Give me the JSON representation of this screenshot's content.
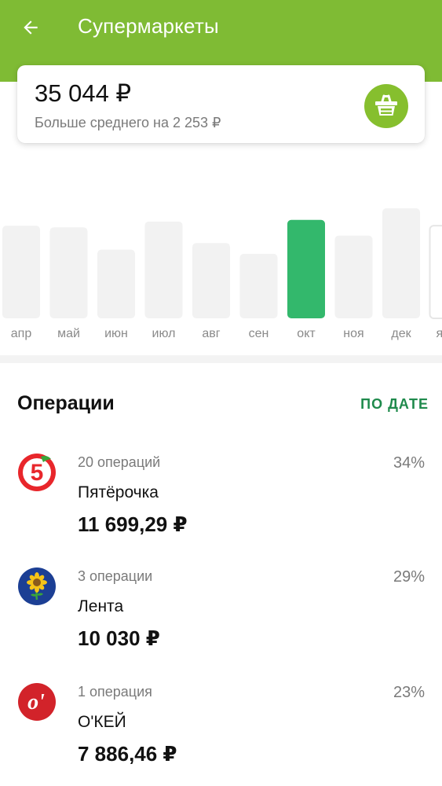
{
  "header": {
    "title": "Супермаркеты",
    "back_icon": "arrow-left-icon",
    "background_color": "#7fbb34"
  },
  "summary": {
    "amount": "35 044 ₽",
    "comparison": "Больше среднего на 2 253 ₽",
    "icon": "basket-icon",
    "icon_color": "#86bf2e"
  },
  "chart_data": {
    "type": "bar",
    "categories": [
      "апр",
      "май",
      "июн",
      "июл",
      "авг",
      "сен",
      "окт",
      "ноя",
      "дек",
      "я"
    ],
    "values": [
      112,
      110,
      83,
      117,
      91,
      78,
      119,
      100,
      133,
      112
    ],
    "selected": "окт",
    "colors": {
      "bar": "#f2f2f2",
      "selected_bar": "#33b86c"
    }
  },
  "operations": {
    "title": "Операции",
    "sort_label": "ПО ДАТЕ",
    "items": [
      {
        "count": "20 операций",
        "name": "Пятёрочка",
        "amount": "11 699,29 ₽",
        "percent": "34%",
        "logo_text": "5",
        "logo_color": "#e8262b"
      },
      {
        "count": "3 операции",
        "name": "Лента",
        "amount": "10 030 ₽",
        "percent": "29%",
        "logo_color": "#1c3f94"
      },
      {
        "count": "1 операция",
        "name": "О'КЕЙ",
        "amount": "7 886,46 ₽",
        "percent": "23%",
        "logo_text": "o'",
        "logo_color": "#d2232a"
      }
    ]
  }
}
